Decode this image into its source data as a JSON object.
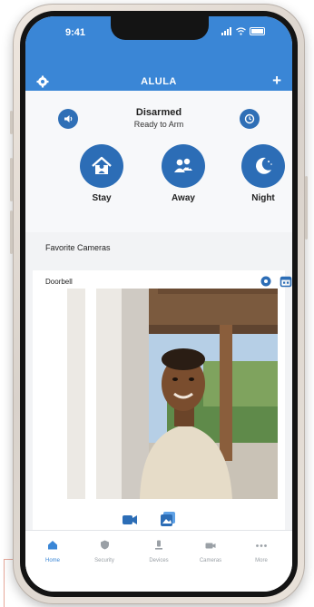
{
  "status_bar": {
    "time": "9:41"
  },
  "header": {
    "title": "ALULA",
    "add_symbol": "+"
  },
  "panel": {
    "state": "Disarmed",
    "substate": "Ready to Arm",
    "arm_buttons": [
      {
        "label": "Stay",
        "icon": "home-person-icon"
      },
      {
        "label": "Away",
        "icon": "people-icon"
      },
      {
        "label": "Night",
        "icon": "moon-icon"
      }
    ]
  },
  "favorites": {
    "section_label": "Favorite Cameras",
    "camera_name": "Doorbell"
  },
  "tabs": [
    {
      "label": "Home",
      "icon": "home-icon",
      "active": true
    },
    {
      "label": "Security",
      "icon": "shield-icon",
      "active": false
    },
    {
      "label": "Devices",
      "icon": "device-icon",
      "active": false
    },
    {
      "label": "Cameras",
      "icon": "camera-icon",
      "active": false
    },
    {
      "label": "More",
      "icon": "more-icon",
      "active": false
    }
  ],
  "colors": {
    "accent": "#3a86d6",
    "button": "#2c6db6",
    "active_tab": "#3a86d6"
  }
}
